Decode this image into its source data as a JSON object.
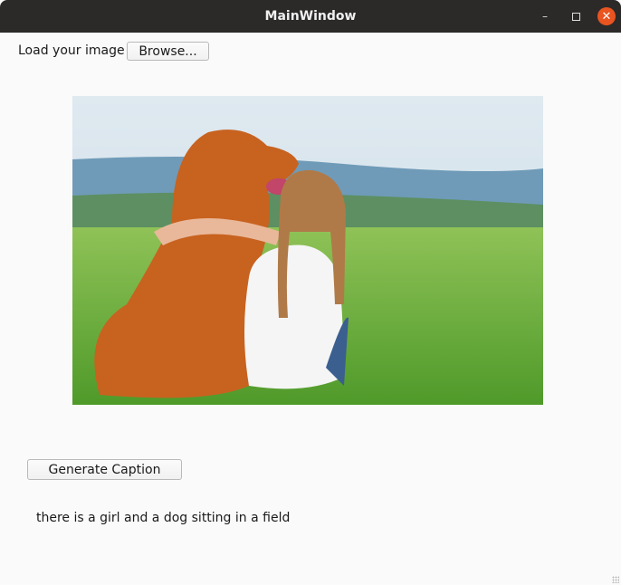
{
  "window": {
    "title": "MainWindow",
    "minimize_icon": "minimize-icon",
    "maximize_icon": "maximize-icon",
    "close_icon": "close-icon",
    "close_color": "#e95420"
  },
  "load": {
    "label": "Load your image",
    "browse_button": "Browse..."
  },
  "image": {
    "alt": "girl and golden retriever sitting in a grassy field"
  },
  "generate_button": "Generate Caption",
  "caption": "there is a girl and a dog sitting in a field"
}
